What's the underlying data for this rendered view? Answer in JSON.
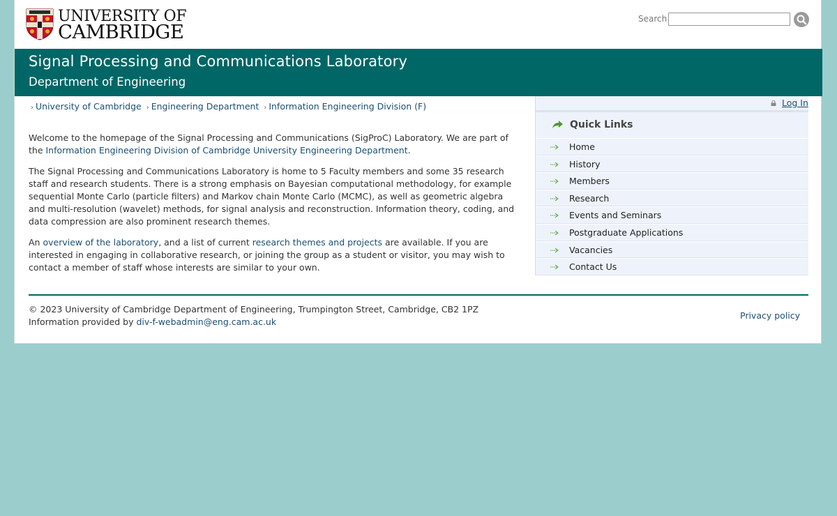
{
  "header": {
    "logo_line1": "UNIVERSITY OF",
    "logo_line2": "CAMBRIDGE",
    "search_label": "Search",
    "search_value": "",
    "search_placeholder": ""
  },
  "banner": {
    "title": "Signal Processing and Communications Laboratory",
    "subtitle": "Department of Engineering"
  },
  "breadcrumb": [
    {
      "label": "University of Cambridge"
    },
    {
      "label": "Engineering Department"
    },
    {
      "label": "Information Engineering Division (F)"
    }
  ],
  "content": {
    "p1_text": "Welcome to the homepage of the Signal Processing and Communications (SigProC) Laboratory. We are part of the ",
    "p1_link": "Information Engineering Division of Cambridge University Engineering Department",
    "p1_end": ".",
    "p2_text": "The Signal Processing and Communications Laboratory is home to 5 Faculty members and some 35 research staff and research students. There is a strong emphasis on Bayesian computational methodology, for example sequential Monte Carlo (particle filters) and Markov chain Monte Carlo (MCMC), as well as geometric algebra and multi-resolution (wavelet) methods, for signal analysis and reconstruction. Information theory, coding, and data compression are also prominent research themes.",
    "p3_start": "An ",
    "p3_link1": "overview of the laboratory",
    "p3_mid": ", and a list of current ",
    "p3_link2": "research themes and projects",
    "p3_end": " are available. If you are interested in engaging in collaborative research, or joining the group as a student or visitor, you may wish to contact a member of staff whose interests are similar to your own."
  },
  "sidebar": {
    "login_label": "Log In",
    "quick_links_title": "Quick Links",
    "items": [
      {
        "label": "Home"
      },
      {
        "label": "History"
      },
      {
        "label": "Members"
      },
      {
        "label": "Research"
      },
      {
        "label": "Events and Seminars"
      },
      {
        "label": "Postgraduate Applications"
      },
      {
        "label": "Vacancies"
      },
      {
        "label": "Contact Us"
      }
    ]
  },
  "footer": {
    "copyright": "© 2023 University of Cambridge Department of Engineering, Trumpington Street, Cambridge, CB2 1PZ",
    "provided_by": "Information provided by ",
    "email": "div-f-webadmin@eng.cam.ac.uk",
    "privacy_label": "Privacy policy"
  },
  "colors": {
    "background": "#9ccdcd",
    "banner": "#006666",
    "link": "#1b4f72",
    "sidebar": "#eef3fb"
  },
  "icons": {
    "logo": "university-crest-icon",
    "search": "magnifier-icon",
    "lock": "lock-icon",
    "quick_links": "green-arrow-icon",
    "list_bullet": "arrow-right-icon"
  }
}
